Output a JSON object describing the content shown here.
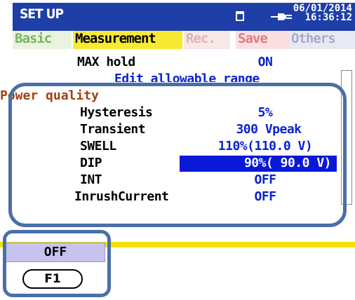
{
  "header": {
    "title": "SET UP",
    "date": "06/01/2014",
    "time": "16:36:12",
    "icons": [
      "document-icon",
      "power-plug-icon"
    ],
    "color": "#1e3fa8"
  },
  "tabs": [
    {
      "label": "Basic",
      "state": "inactive",
      "color": "#7bb35c"
    },
    {
      "label": "Measurement",
      "state": "active",
      "color": "#f6ea35"
    },
    {
      "label": "Rec.",
      "state": "inactive",
      "color": "#e2b2b2"
    },
    {
      "label": "Save",
      "state": "inactive",
      "color": "#e07a82"
    },
    {
      "label": "Others",
      "state": "inactive",
      "color": "#a9a9c8"
    }
  ],
  "rows": {
    "max_hold": {
      "label": "MAX hold",
      "value": "ON"
    },
    "edit_range": {
      "label": "Edit allowable range"
    },
    "power_quality": {
      "label": "Power quality"
    },
    "hysteresis": {
      "label": "Hysteresis",
      "value": "5%"
    },
    "transient": {
      "label": "Transient",
      "value": "300 Vpeak"
    },
    "swell": {
      "label": "SWELL",
      "value": "110%(110.0 V)"
    },
    "dip": {
      "label": "DIP",
      "value": "90%( 90.0 V)"
    },
    "int": {
      "label": "INT",
      "value": "OFF"
    },
    "inrush": {
      "label": "InrushCurrent",
      "value": "OFF"
    }
  },
  "fkeys": {
    "f1_label": "OFF",
    "f1_key": "F1"
  },
  "colors": {
    "value_blue": "#0b22d0",
    "highlight_bg": "#0a18d8",
    "highlight_outline": "#4a6fa8"
  }
}
